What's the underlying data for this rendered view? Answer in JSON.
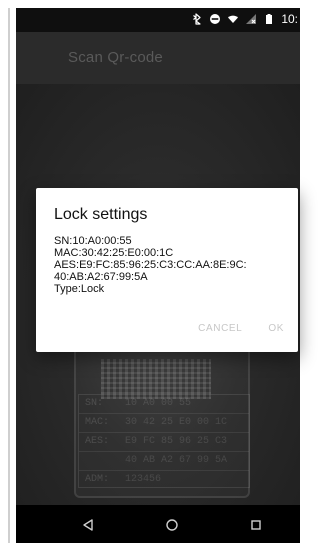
{
  "status_bar": {
    "time": "10:",
    "icons": [
      "bluetooth-icon",
      "do-not-disturb-icon",
      "wifi-icon",
      "no-signal-icon",
      "battery-icon"
    ]
  },
  "app_bar": {
    "title": "Scan Qr-code"
  },
  "camera_preview": {
    "label_rows": [
      {
        "key": "SN:",
        "value": "10 A0 00 55"
      },
      {
        "key": "MAC:",
        "value": "30 42 25 E0 00 1C"
      },
      {
        "key": "AES:",
        "value": "E9 FC 85 96 25 C3"
      },
      {
        "key": "",
        "value": "40 AB A2 67 99 5A"
      },
      {
        "key": "ADM:",
        "value": "123456"
      }
    ]
  },
  "dialog": {
    "title": "Lock settings",
    "lines": [
      "SN:10:A0:00:55",
      "MAC:30:42:25:E0:00:1C",
      "AES:E9:FC:85:96:25:C3:CC:AA:8E:9C:",
      "40:AB:A2:67:99:5A",
      "Type:Lock"
    ],
    "buttons": {
      "cancel": "CANCEL",
      "ok": "OK"
    }
  },
  "nav_bar": {
    "icons": [
      "back-icon",
      "home-icon",
      "recent-apps-icon"
    ]
  }
}
